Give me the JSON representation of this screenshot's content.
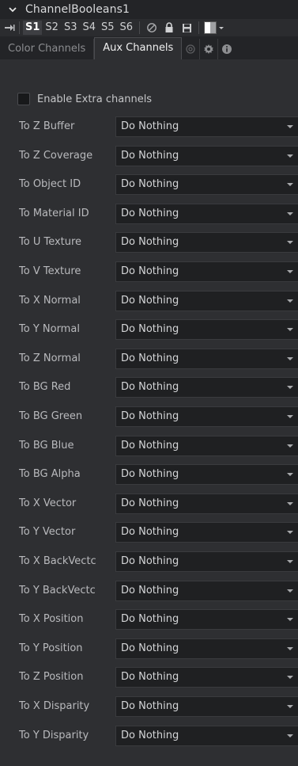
{
  "header": {
    "title": "ChannelBooleans1",
    "collapse_icon": "chevron-down-icon"
  },
  "toolbar": {
    "pin_icon": "pin-icon",
    "slots": [
      "S1",
      "S2",
      "S3",
      "S4",
      "S5",
      "S6"
    ],
    "active_slot": "S1",
    "icons": [
      "disable-icon",
      "lock-icon",
      "save-icon"
    ],
    "swatch_icon": "color-swatch-icon"
  },
  "tabs": [
    {
      "label": "Color Channels",
      "active": false
    },
    {
      "label": "Aux Channels",
      "active": true
    }
  ],
  "tab_icons": [
    "settings-alt-icon",
    "gear-icon",
    "info-icon"
  ],
  "enable_extra": {
    "label": "Enable Extra channels",
    "checked": false
  },
  "rows": [
    {
      "label": "To Z Buffer",
      "value": "Do Nothing"
    },
    {
      "label": "To Z Coverage",
      "value": "Do Nothing"
    },
    {
      "label": "To Object ID",
      "value": "Do Nothing"
    },
    {
      "label": "To Material ID",
      "value": "Do Nothing"
    },
    {
      "label": "To U Texture",
      "value": "Do Nothing"
    },
    {
      "label": "To V Texture",
      "value": "Do Nothing"
    },
    {
      "label": "To X Normal",
      "value": "Do Nothing"
    },
    {
      "label": "To Y Normal",
      "value": "Do Nothing"
    },
    {
      "label": "To Z Normal",
      "value": "Do Nothing"
    },
    {
      "label": "To BG Red",
      "value": "Do Nothing"
    },
    {
      "label": "To BG Green",
      "value": "Do Nothing"
    },
    {
      "label": "To BG Blue",
      "value": "Do Nothing"
    },
    {
      "label": "To BG Alpha",
      "value": "Do Nothing"
    },
    {
      "label": "To X Vector",
      "value": "Do Nothing"
    },
    {
      "label": "To Y Vector",
      "value": "Do Nothing"
    },
    {
      "label": "To X BackVectc",
      "value": "Do Nothing"
    },
    {
      "label": "To Y BackVectc",
      "value": "Do Nothing"
    },
    {
      "label": "To X Position",
      "value": "Do Nothing"
    },
    {
      "label": "To Y Position",
      "value": "Do Nothing"
    },
    {
      "label": "To Z Position",
      "value": "Do Nothing"
    },
    {
      "label": "To X Disparity",
      "value": "Do Nothing"
    },
    {
      "label": "To Y Disparity",
      "value": "Do Nothing"
    }
  ],
  "colors": {
    "panel_bg": "#2e2f32",
    "header_bg": "#232427",
    "dropdown_bg": "#1f2022",
    "text": "#c5c6c8"
  }
}
